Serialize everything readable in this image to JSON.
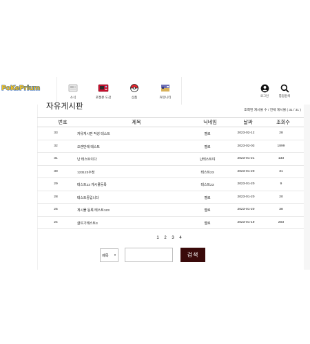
{
  "brand": {
    "logo_text": "PoKePrium"
  },
  "nav": {
    "items": [
      {
        "label": "소식"
      },
      {
        "label": "포켓몬 도감"
      },
      {
        "label": "상품"
      },
      {
        "label": "커뮤니티"
      }
    ]
  },
  "header_actions": {
    "login_label": "로그인",
    "search_label": "통합검색"
  },
  "board": {
    "title": "자유게시판",
    "count_text": "조회된 게시물 수 / 전체 게시물 ( 31 / 31 )",
    "columns": [
      "번호",
      "제목",
      "닉네임",
      "날짜",
      "조회수"
    ],
    "rows": [
      {
        "num": "33",
        "title": "자유게시판 작성 테스트",
        "nick": "멜로",
        "date": "2023-02-12",
        "views": "28"
      },
      {
        "num": "32",
        "title": "오랜만에 테스트",
        "nick": "멜로",
        "date": "2023-02-03",
        "views": "1899"
      },
      {
        "num": "31",
        "title": "난 테스트이다",
        "nick": "난테스트야",
        "date": "2023-01-21",
        "views": "133"
      },
      {
        "num": "30",
        "title": "123123수정",
        "nick": "테스트23",
        "date": "2023-01-20",
        "views": "31"
      },
      {
        "num": "29",
        "title": "테스트23 게시물등록",
        "nick": "테스트23",
        "date": "2023-01-20",
        "views": "9"
      },
      {
        "num": "28",
        "title": "테스트중입니다",
        "nick": "멜로",
        "date": "2023-01-20",
        "views": "20"
      },
      {
        "num": "25",
        "title": "게시물 등록 테스트123",
        "nick": "멜로",
        "date": "2023-01-20",
        "views": "38"
      },
      {
        "num": "24",
        "title": "글뜨기테스트3",
        "nick": "멜로",
        "date": "2023-01-19",
        "views": "203"
      }
    ]
  },
  "pagination": {
    "pages": [
      "1",
      "2",
      "3",
      "4"
    ]
  },
  "search": {
    "select_value": "제목",
    "input_value": "",
    "button_label": "검색"
  },
  "colors": {
    "search_button": "#3a0a0a",
    "logo_fill": "#f6c21b",
    "logo_stroke": "#2a62b3"
  },
  "icons": {
    "nav": [
      "news-icon",
      "pokedex-icon",
      "pokeball-icon",
      "community-icon"
    ],
    "header": [
      "user-icon",
      "search-icon"
    ]
  }
}
